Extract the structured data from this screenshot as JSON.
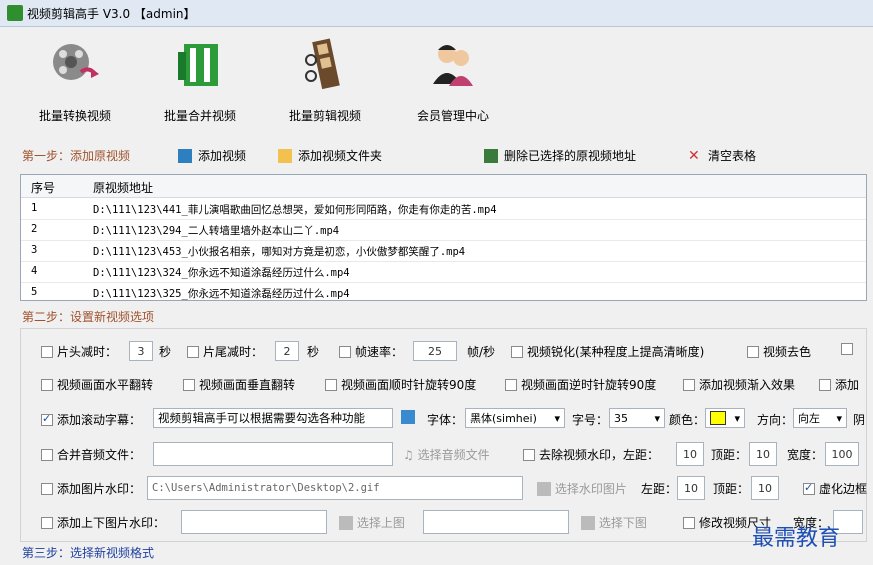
{
  "window": {
    "title": "视频剪辑高手 V3.0  【admin】"
  },
  "toolbar": [
    {
      "label": "批量转换视频"
    },
    {
      "label": "批量合并视频"
    },
    {
      "label": "批量剪辑视频"
    },
    {
      "label": "会员管理中心"
    }
  ],
  "step1": {
    "title": "第一步：添加原视频",
    "add_video": "添加视频",
    "add_folder": "添加视频文件夹",
    "delete_selected": "删除已选择的原视频地址",
    "clear_table": "清空表格"
  },
  "table": {
    "headers": [
      "序号",
      "原视频地址"
    ],
    "rows": [
      {
        "no": "1",
        "path": "D:\\111\\123\\441_菲儿演唱歌曲回忆总想哭，爱如何形同陌路，你走有你走的苦.mp4"
      },
      {
        "no": "2",
        "path": "D:\\111\\123\\294_二人转墙里墙外赵本山二丫.mp4"
      },
      {
        "no": "3",
        "path": "D:\\111\\123\\453_小伙报名相亲，哪知对方竟是初恋，小伙傲梦都笑醒了.mp4"
      },
      {
        "no": "4",
        "path": "D:\\111\\123\\324_你永远不知道涂磊经历过什么.mp4"
      },
      {
        "no": "5",
        "path": "D:\\111\\123\\325_你永远不知道涂磊经历过什么.mp4"
      }
    ]
  },
  "step2": {
    "title": "第二步：设置新视频选项",
    "head_cut": "片头减时：",
    "head_val": "3",
    "sec1": "秒",
    "tail_cut": "片尾减时：",
    "tail_val": "2",
    "sec2": "秒",
    "fps": "帧速率：",
    "fps_val": "25",
    "fps_unit": "帧/秒",
    "sharpen": "视频锐化(某种程度上提高清晰度)",
    "decolor": "视频去色",
    "flip_h": "视频画面水平翻转",
    "flip_v": "视频画面垂直翻转",
    "rot_cw": "视频画面顺时针旋转90度",
    "rot_ccw": "视频画面逆时针旋转90度",
    "fade_in": "添加视频渐入效果",
    "add_more": "添加",
    "scroll_sub": "添加滚动字幕：",
    "scroll_text": "视频剪辑高手可以根据需要勾选各种功能",
    "font_label": "字体：",
    "font_val": "黑体(simhei)",
    "size_label": "字号：",
    "size_val": "35",
    "color_label": "颜色：",
    "dir_label": "方向：",
    "dir_val": "向左",
    "shadow": "阴",
    "merge_audio": "合并音频文件：",
    "choose_audio": "选择音频文件",
    "remove_wm": "去除视频水印，左距：",
    "rm_left": "10",
    "top_label": "顶距：",
    "rm_top": "10",
    "width_label": "宽度：",
    "rm_width": "100",
    "img_wm": "添加图片水印：",
    "img_wm_path": "C:\\Users\\Administrator\\Desktop\\2.gif",
    "choose_wm": "选择水印图片",
    "left_label": "左距：",
    "wm_left": "10",
    "top_label2": "顶距：",
    "wm_top": "10",
    "blur_border": "虚化边框",
    "tb_wm": "添加上下图片水印：",
    "choose_top": "选择上图",
    "choose_bottom": "选择下图",
    "resize": "修改视频尺寸",
    "width_label2": "宽度："
  },
  "step3": {
    "title": "第三步：选择新视频格式"
  },
  "watermark_text": "最需教育"
}
